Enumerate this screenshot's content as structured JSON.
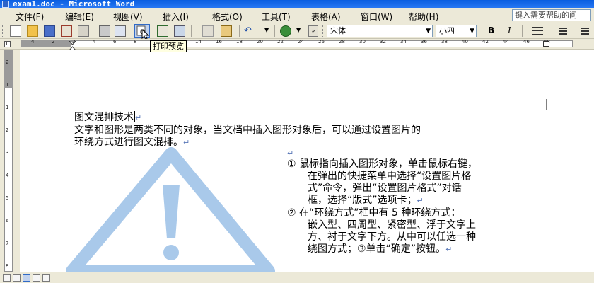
{
  "window": {
    "title": "exam1.doc - Microsoft Word"
  },
  "menu": {
    "items": [
      "文件(F)",
      "编辑(E)",
      "视图(V)",
      "插入(I)",
      "格式(O)",
      "工具(T)",
      "表格(A)",
      "窗口(W)",
      "帮助(H)"
    ],
    "help_placeholder": "键入需要帮助的问"
  },
  "toolbar": {
    "font_name": "宋体",
    "font_size": "小四",
    "bold": "B",
    "italic": "I",
    "tooltip": "打印预览"
  },
  "ruler": {
    "h_ticks": [
      "4",
      "2",
      "2",
      "4",
      "6",
      "8",
      "10",
      "12",
      "14",
      "16",
      "18",
      "20",
      "22",
      "24",
      "26",
      "28",
      "30",
      "32",
      "34",
      "36",
      "38",
      "40",
      "42",
      "44",
      "46",
      "48"
    ],
    "v_ticks": [
      "2",
      "1",
      "1",
      "2",
      "3",
      "4",
      "5",
      "6",
      "7",
      "8"
    ]
  },
  "document": {
    "title": "图文混排技术",
    "para1_line1": "文字和图形是两类不同的对象，当文档中插入图形对象后，可以通过设置图片的",
    "para1_line2": "环绕方式进行图文混排。",
    "step_lines": [
      "① 鼠标指向插入图形对象，单击鼠标右键，",
      "在弹出的快捷菜单中选择“设置图片格",
      "式”命令，弹出“设置图片格式”对话",
      "框，选择“版式”选项卡；",
      "② 在“环绕方式”框中有 5 种环绕方式：",
      "嵌入型、四周型、紧密型、浮于文字上",
      "方、衬于文字下方。从中可以任选一种",
      "绕图方式；③单击“确定”按钮。"
    ],
    "para_mark": "↵"
  },
  "colors": {
    "title_bar": "#0a5ee0",
    "chrome": "#ece9d8",
    "warning_icon": "#a9c9ea"
  }
}
